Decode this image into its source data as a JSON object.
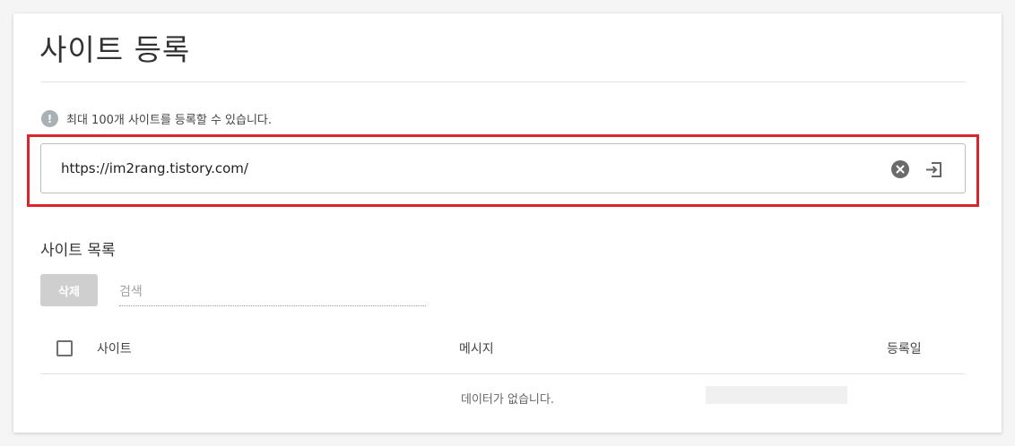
{
  "page": {
    "title": "사이트 등록"
  },
  "notice": {
    "icon": "exclamation-icon",
    "symbol": "!",
    "text": "최대 100개 사이트를 등록할 수 있습니다."
  },
  "url_input": {
    "value": "https://im2rang.tistory.com/",
    "clear_icon": "clear-circle-icon",
    "submit_icon": "enter-icon"
  },
  "site_list": {
    "title": "사이트 목록",
    "delete_label": "삭제",
    "search_placeholder": "검색",
    "columns": {
      "site": "사이트",
      "message": "메시지",
      "registered": "등록일"
    },
    "empty_message": "데이터가 없습니다."
  },
  "colors": {
    "highlight": "#d9252b",
    "disabled_button": "#cfcfcf",
    "notice_icon": "#a9b1b7"
  }
}
